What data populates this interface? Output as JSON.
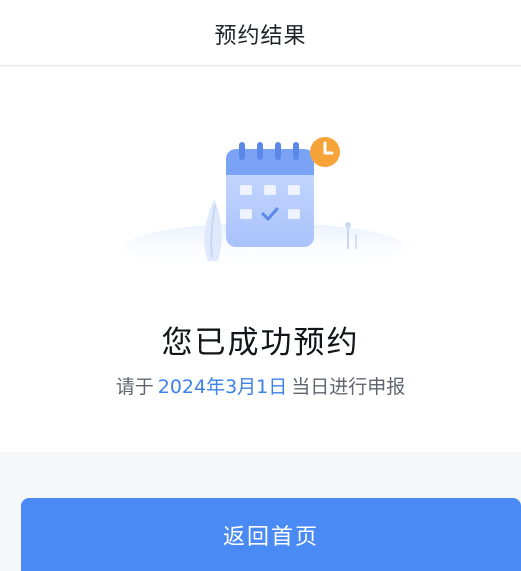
{
  "header": {
    "title": "预约结果"
  },
  "result": {
    "illustration_icon": "calendar-clock-icon",
    "title": "您已成功预约",
    "subtitle_prefix": "请于",
    "date": "2024年3月1日",
    "subtitle_suffix": "当日进行申报"
  },
  "actions": {
    "back_home_label": "返回首页"
  },
  "colors": {
    "primary": "#4a8af4",
    "highlight": "#3b82e8",
    "accent_clock": "#f6a43a",
    "page_background": "#f6f7f9"
  }
}
